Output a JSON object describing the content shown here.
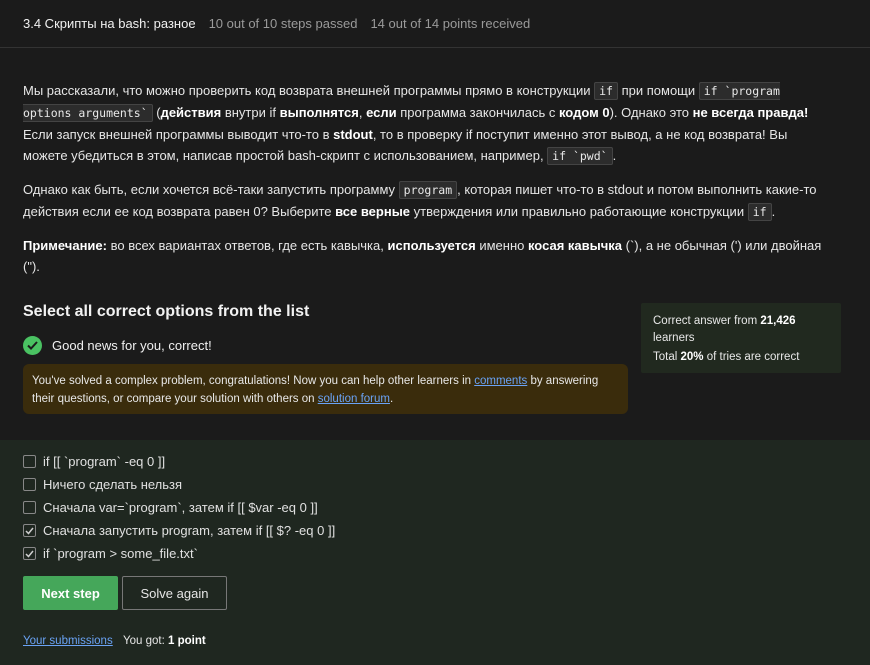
{
  "header": {
    "title": "3.4 Скрипты на bash: разное",
    "steps": "10 out of 10 steps passed",
    "points": "14 out of 14 points  received"
  },
  "task": {
    "p1": {
      "t1": "Мы рассказали, что можно проверить код возврата внешней программы прямо в конструкции ",
      "c1": "if",
      "t2": " при помощи ",
      "c2": "if `program options arguments`",
      "t3": " (",
      "b1": "действия",
      "t4": " внутри if ",
      "b2": "выполнятся",
      "t5": ", ",
      "b3": "если",
      "t6": " программа закончилась с ",
      "b4": "кодом 0",
      "t7": "). Однако это ",
      "b5": "не всегда правда!",
      "t8": " Если запуск внешней программы выводит что-то в ",
      "b6": "stdout",
      "t9": ", то в проверку if поступит именно этот вывод, а не код возврата! Вы можете убедиться в этом, написав простой bash-скрипт с использованием, например, ",
      "c3": "if `pwd`",
      "t10": "."
    },
    "p2": {
      "t1": "Однако как быть, если хочется всё-таки запустить программу ",
      "c1": "program",
      "t2": ", которая пишет что-то в stdout и потом выполнить какие-то действия если ее код возврата равен 0? Выберите ",
      "b1": "все верные",
      "t3": " утверждения или правильно работающие конструкции ",
      "c2": "if",
      "t4": "."
    },
    "p3": {
      "b1": "Примечание:",
      "t1": " во всех вариантах ответов, где есть кавычка, ",
      "b2": "используется",
      "t2": " именно ",
      "b3": "косая кавычка",
      "t3": " (`), а не обычная (') или двойная (\")."
    }
  },
  "quiz": {
    "title": "Select all correct options from the list",
    "correct_message": "Good news for you, correct!",
    "info": {
      "t1": "You've solved a complex problem, congratulations! Now you can help other learners in ",
      "link1": "comments",
      "t2": " by answering their questions, or compare your solution with others on ",
      "link2": "solution forum",
      "t3": "."
    },
    "options": [
      {
        "label": "if [[ `program` -eq 0 ]]",
        "checked": false
      },
      {
        "label": "Ничего сделать нельзя",
        "checked": false
      },
      {
        "label": "Сначала var=`program`, затем if [[ $var -eq 0 ]]",
        "checked": false
      },
      {
        "label": "Сначала запустить program, затем if [[ $? -eq 0 ]]",
        "checked": true
      },
      {
        "label": "if `program > some_file.txt`",
        "checked": true
      }
    ],
    "next_label": "Next step",
    "solve_label": "Solve again"
  },
  "stats": {
    "t1": "Correct answer from ",
    "learners": "21,426",
    "t2": " learners",
    "t3": "Total ",
    "percent": "20%",
    "t4": " of tries are correct"
  },
  "footer": {
    "submissions": "Your submissions",
    "got": "You got: ",
    "score": "1 point"
  },
  "colors": {
    "accent_green": "#45a75a",
    "link_blue": "#6aa3f5",
    "info_bg": "#3a2c0c",
    "options_bg": "#1f2720"
  }
}
